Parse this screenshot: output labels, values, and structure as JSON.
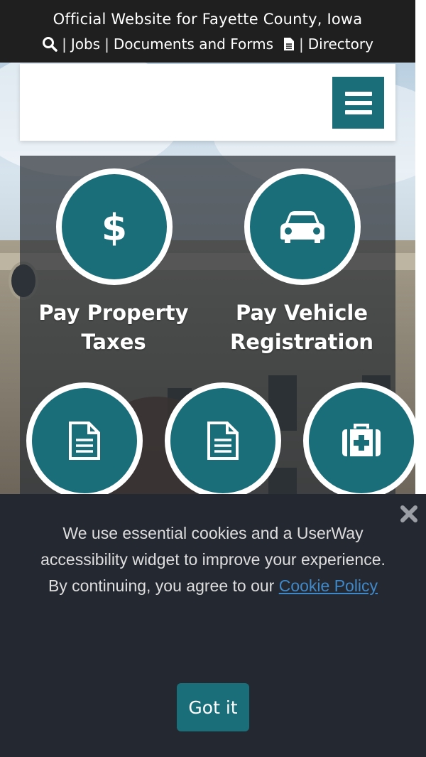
{
  "topbar": {
    "title": "Official Website for Fayette County, Iowa",
    "jobs": "Jobs",
    "documents": "Documents and Forms",
    "directory": "Directory",
    "separator": "|"
  },
  "quick_links": [
    {
      "label_line1": "Pay Property",
      "label_line2": "Taxes",
      "icon": "dollar-icon"
    },
    {
      "label_line1": "Pay Vehicle",
      "label_line2": "Registration",
      "icon": "car-icon"
    },
    {
      "icon": "document-icon"
    },
    {
      "icon": "document-icon"
    },
    {
      "icon": "medical-kit-icon"
    }
  ],
  "cookie": {
    "line1": "We use essential cookies and a UserWay accessibility widget to improve your experience.",
    "line2_prefix": "By continuing, you agree to our",
    "link": "Cookie Policy",
    "button": "Got it"
  },
  "colors": {
    "teal": "#1a6e79",
    "topbar": "#1f1f20",
    "cookie_bg": "#242831",
    "link": "#3f88c9"
  }
}
